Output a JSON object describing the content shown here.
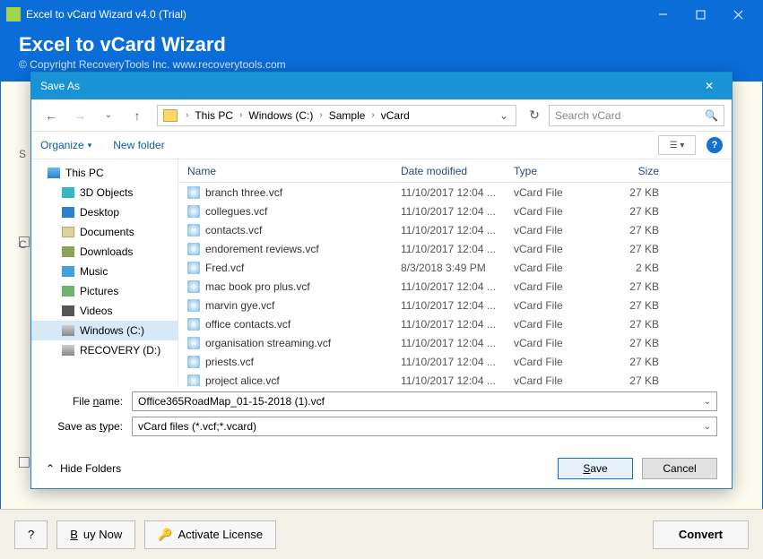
{
  "window": {
    "title": "Excel to vCard Wizard v4.0 (Trial)",
    "banner_title": "Excel to vCard Wizard",
    "copyright": "© Copyright RecoveryTools Inc. www.recoverytools.com"
  },
  "bottom": {
    "help": "?",
    "buy": "Buy Now",
    "buy_prefix": "B",
    "buy_suffix": "uy Now",
    "activate": "Activate License",
    "convert": "Convert"
  },
  "dialog": {
    "title": "Save As",
    "organize": "Organize",
    "new_folder": "New folder",
    "hide_folders": "Hide Folders",
    "save_btn": "Save",
    "save_underline": "S",
    "save_rest": "ave",
    "cancel_btn": "Cancel",
    "search_placeholder": "Search vCard",
    "breadcrumbs": [
      "This PC",
      "Windows (C:)",
      "Sample",
      "vCard"
    ]
  },
  "fields": {
    "name_label": "File name:",
    "name_underline_pos": "n",
    "name_prefix": "File ",
    "name_suffix": "ame:",
    "name_value": "Office365RoadMap_01-15-2018 (1).vcf",
    "type_label": "Save as type:",
    "type_underline": "t",
    "type_prefix": "Save as ",
    "type_suffix": "ype:",
    "type_value": "vCard files (*.vcf;*.vcard)"
  },
  "columns": {
    "name": "Name",
    "date": "Date modified",
    "type": "Type",
    "size": "Size"
  },
  "tree": [
    {
      "label": "This PC",
      "icon": "ic-pc",
      "indent": false,
      "sel": false
    },
    {
      "label": "3D Objects",
      "icon": "ic-3d",
      "indent": true,
      "sel": false
    },
    {
      "label": "Desktop",
      "icon": "ic-desktop",
      "indent": true,
      "sel": false
    },
    {
      "label": "Documents",
      "icon": "ic-docs",
      "indent": true,
      "sel": false
    },
    {
      "label": "Downloads",
      "icon": "ic-down",
      "indent": true,
      "sel": false
    },
    {
      "label": "Music",
      "icon": "ic-music",
      "indent": true,
      "sel": false
    },
    {
      "label": "Pictures",
      "icon": "ic-pics",
      "indent": true,
      "sel": false
    },
    {
      "label": "Videos",
      "icon": "ic-video",
      "indent": true,
      "sel": false
    },
    {
      "label": "Windows (C:)",
      "icon": "ic-drive",
      "indent": true,
      "sel": true
    },
    {
      "label": "RECOVERY (D:)",
      "icon": "ic-drive",
      "indent": true,
      "sel": false
    }
  ],
  "files": [
    {
      "name": "branch three.vcf",
      "date": "11/10/2017 12:04 ...",
      "type": "vCard File",
      "size": "27 KB"
    },
    {
      "name": "collegues.vcf",
      "date": "11/10/2017 12:04 ...",
      "type": "vCard File",
      "size": "27 KB"
    },
    {
      "name": "contacts.vcf",
      "date": "11/10/2017 12:04 ...",
      "type": "vCard File",
      "size": "27 KB"
    },
    {
      "name": "endorement reviews.vcf",
      "date": "11/10/2017 12:04 ...",
      "type": "vCard File",
      "size": "27 KB"
    },
    {
      "name": "Fred.vcf",
      "date": "8/3/2018 3:49 PM",
      "type": "vCard File",
      "size": "2 KB"
    },
    {
      "name": "mac book pro plus.vcf",
      "date": "11/10/2017 12:04 ...",
      "type": "vCard File",
      "size": "27 KB"
    },
    {
      "name": "marvin gye.vcf",
      "date": "11/10/2017 12:04 ...",
      "type": "vCard File",
      "size": "27 KB"
    },
    {
      "name": "office contacts.vcf",
      "date": "11/10/2017 12:04 ...",
      "type": "vCard File",
      "size": "27 KB"
    },
    {
      "name": "organisation streaming.vcf",
      "date": "11/10/2017 12:04 ...",
      "type": "vCard File",
      "size": "27 KB"
    },
    {
      "name": "priests.vcf",
      "date": "11/10/2017 12:04 ...",
      "type": "vCard File",
      "size": "27 KB"
    },
    {
      "name": "project alice.vcf",
      "date": "11/10/2017 12:04 ...",
      "type": "vCard File",
      "size": "27 KB"
    }
  ],
  "behind": {
    "s": "S",
    "c": "C"
  }
}
